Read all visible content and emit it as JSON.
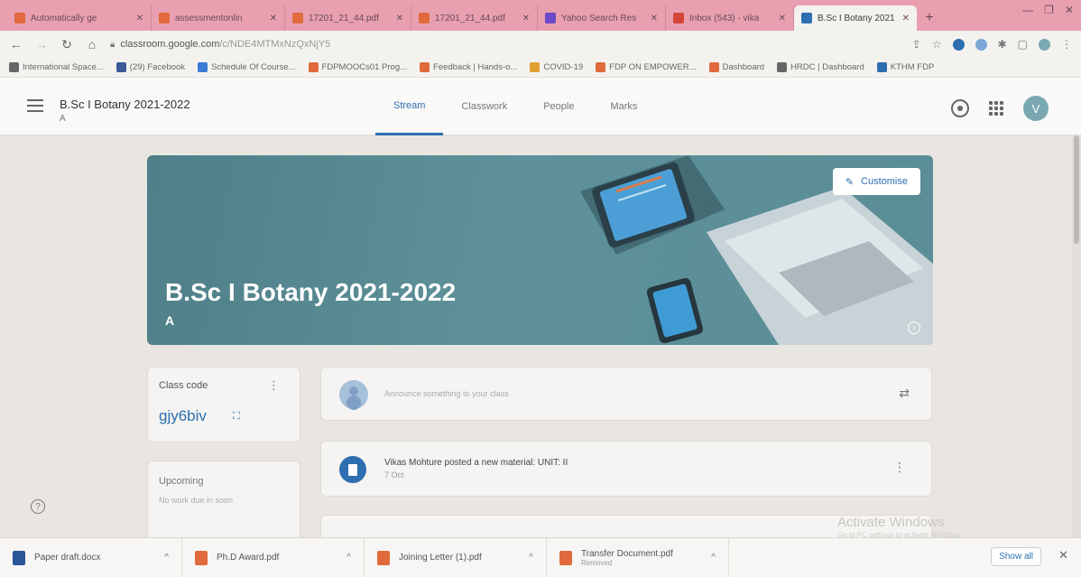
{
  "browser": {
    "tabs": [
      {
        "title": "Automatically ge",
        "color": "#e06a3c"
      },
      {
        "title": "assessmentonlin",
        "color": "#e06a3c"
      },
      {
        "title": "17201_21_44.pdf",
        "color": "#e06a3c"
      },
      {
        "title": "17201_21_44.pdf",
        "color": "#e06a3c"
      },
      {
        "title": "Yahoo Search Res",
        "color": "#6a4ac8"
      },
      {
        "title": "Inbox (543) - vika",
        "color": "#d44638"
      },
      {
        "title": "B.Sc I Botany 2021",
        "color": "#2d6fb0"
      }
    ],
    "url_main": "classroom.google.com",
    "url_path": "/c/NDE4MTMxNzQxNjY5",
    "bookmarks": [
      {
        "label": "International Space...",
        "color": "#666666"
      },
      {
        "label": "(29) Facebook",
        "color": "#3b5998"
      },
      {
        "label": "Schedule Of Course...",
        "color": "#3a7bd5"
      },
      {
        "label": "FDPMOOCs01 Prog...",
        "color": "#e06a3c"
      },
      {
        "label": "Feedback | Hands-o...",
        "color": "#e06a3c"
      },
      {
        "label": "COVID-19",
        "color": "#e0a030"
      },
      {
        "label": "FDP ON EMPOWER...",
        "color": "#e06a3c"
      },
      {
        "label": "Dashboard",
        "color": "#e06a3c"
      },
      {
        "label": "HRDC | Dashboard",
        "color": "#666666"
      },
      {
        "label": "KTHM FDP",
        "color": "#2d6fb0"
      }
    ]
  },
  "classroom": {
    "class_name": "B.Sc I Botany 2021-2022",
    "section": "A",
    "nav_tabs": [
      "Stream",
      "Classwork",
      "People",
      "Marks"
    ],
    "avatar_letter": "V",
    "banner_title": "B.Sc I Botany 2021-2022",
    "banner_section": "A",
    "customise_label": "Customise",
    "class_code_label": "Class code",
    "class_code": "gjy6biv",
    "upcoming_label": "Upcoming",
    "upcoming_text": "No work due in soon",
    "announce_placeholder": "Announce something to your class",
    "post_title": "Vikas Mohture posted a new material: UNIT: II",
    "post_date": "7 Oct",
    "accent": "#2d6fb0"
  },
  "overlay": {
    "activate_title": "Activate Windows",
    "activate_sub": "Go to PC settings to activate Windows."
  },
  "downloads": {
    "items": [
      {
        "name": "Paper draft.docx",
        "sub": "",
        "color": "#2b579a"
      },
      {
        "name": "Ph.D Award.pdf",
        "sub": "",
        "color": "#e06a3c"
      },
      {
        "name": "Joining Letter (1).pdf",
        "sub": "",
        "color": "#e06a3c"
      },
      {
        "name": "Transfer Document.pdf",
        "sub": "Removed",
        "color": "#e06a3c"
      }
    ],
    "show_all": "Show all"
  }
}
